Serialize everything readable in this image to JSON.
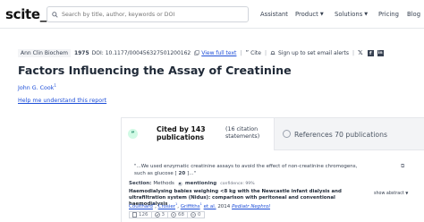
{
  "nav": {
    "logo": "scite_",
    "search_placeholder": "Search by title, author, keywords or DOI",
    "links": [
      "Assistant",
      "Product",
      "Solutions",
      "Pricing",
      "Blog"
    ]
  },
  "meta": {
    "journal": "Ann Clin Biochem",
    "year": "1975",
    "doi": "DOI: 10.1177/000456327501200162",
    "view_full_text": "View full text",
    "cite": "Cite",
    "alerts": "Sign up to set email alerts"
  },
  "paper": {
    "title": "Factors Influencing the Assay of Creatinine",
    "author": "John G. Cook",
    "author_sup": "1",
    "help_link": "Help me understand this report"
  },
  "tabs": {
    "cited_by": "Cited by 143 publications",
    "cited_count": "(16 citation statements)",
    "references": "References 70 publications"
  },
  "citation": {
    "quote_pre": "\"...We used enzymatic creatinine assays to avoid the effect of non-creatinine chromogens, such as glucose [",
    "quote_ref": " 20 ",
    "quote_post": "]...\"",
    "section_label": "Section:",
    "section_value": "Methods",
    "classification": "mentioning",
    "confidence": "confidence: 99%",
    "paper_title": "Haemodialysing babies weighing <8 kg with the Newcastle infant dialysis and ultrafiltration system (Nidus): comparison with peritoneal and conventional haemodialysis",
    "show_abstract": "show abstract",
    "authors": [
      "Coulthard",
      "Crosier",
      "Griffiths"
    ],
    "et_al": "et al.",
    "year": "2014",
    "journal": "Pediatr Nephrol",
    "stats": [
      "126",
      "3",
      "68",
      "0"
    ]
  },
  "colors": {
    "accent": "#1d4ed8",
    "tab_inactive_bg": "#f3f4f6",
    "quote_icon_bg": "#d1fae5"
  }
}
